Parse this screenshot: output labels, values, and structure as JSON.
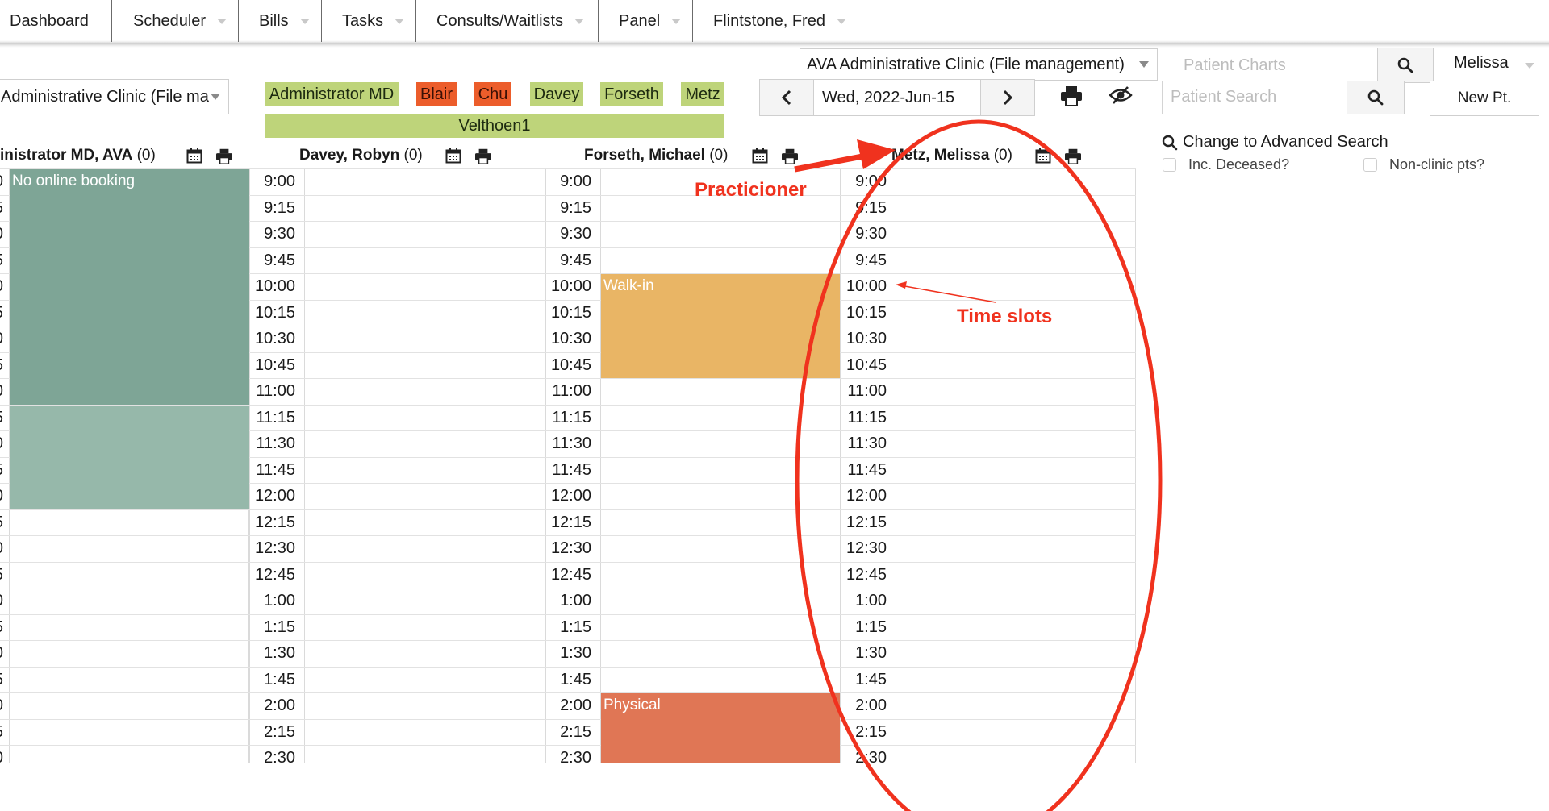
{
  "nav": {
    "items": [
      {
        "label": "Dashboard",
        "caret": false
      },
      {
        "label": "Scheduler",
        "caret": true
      },
      {
        "label": "Bills",
        "caret": true
      },
      {
        "label": "Tasks",
        "caret": true
      },
      {
        "label": "Consults/Waitlists",
        "caret": true
      },
      {
        "label": "Panel",
        "caret": true
      },
      {
        "label": "Flintstone, Fred",
        "caret": true
      }
    ]
  },
  "header": {
    "clinic_select": "AVA Administrative Clinic (File management)",
    "patient_charts_placeholder": "Patient Charts",
    "user": "Melissa"
  },
  "scheduler": {
    "clinic_select": "Administrative Clinic (File ma",
    "providers": [
      {
        "label": "Administrator MD",
        "color": "#bed47a"
      },
      {
        "label": "Blair",
        "color": "#ec5d2b"
      },
      {
        "label": "Chu",
        "color": "#ec5d2b"
      },
      {
        "label": "Davey",
        "color": "#bed47a"
      },
      {
        "label": "Forseth",
        "color": "#bed47a"
      },
      {
        "label": "Metz",
        "color": "#bed47a"
      }
    ],
    "group": {
      "label": "Velthoen1",
      "color": "#bed47a"
    },
    "date": "Wed, 2022-Jun-15",
    "columns": [
      {
        "name": "inistrator MD, AVA",
        "count": "(0)"
      },
      {
        "name": "Davey, Robyn",
        "count": "(0)"
      },
      {
        "name": "Forseth, Michael",
        "count": "(0)"
      },
      {
        "name": "Metz, Melissa",
        "count": "(0)"
      }
    ],
    "times": [
      "9:00",
      "9:15",
      "9:30",
      "9:45",
      "10:00",
      "10:15",
      "10:30",
      "10:45",
      "11:00",
      "11:15",
      "11:30",
      "11:45",
      "12:00",
      "12:15",
      "12:30",
      "12:45",
      "1:00",
      "1:15",
      "1:30",
      "1:45",
      "2:00",
      "2:15",
      "2:30"
    ],
    "edge_digits": [
      "0",
      "5",
      "0",
      "5",
      "0",
      "5",
      "0",
      "5",
      "0",
      "5",
      "0",
      "5",
      "0",
      "5",
      "0",
      "5",
      "0",
      "5",
      "0",
      "5",
      "0",
      "5",
      "0"
    ],
    "appointments": [
      {
        "label": "No online booking",
        "color": "#7ea596"
      },
      {
        "label": "",
        "color": "#96b8aa"
      },
      {
        "label": "Walk-in",
        "color": "#e9b565"
      },
      {
        "label": "Physical",
        "color": "#e07655"
      }
    ]
  },
  "sidebar": {
    "patient_search_placeholder": "Patient Search",
    "new_patient": "New Pt.",
    "advanced_search": "Change to Advanced Search",
    "inc_deceased": "Inc. Deceased?",
    "non_clinic": "Non-clinic pts?"
  },
  "annotations": {
    "practitioner": "Practicioner",
    "time_slots": "Time slots",
    "color": "#f0321e"
  }
}
